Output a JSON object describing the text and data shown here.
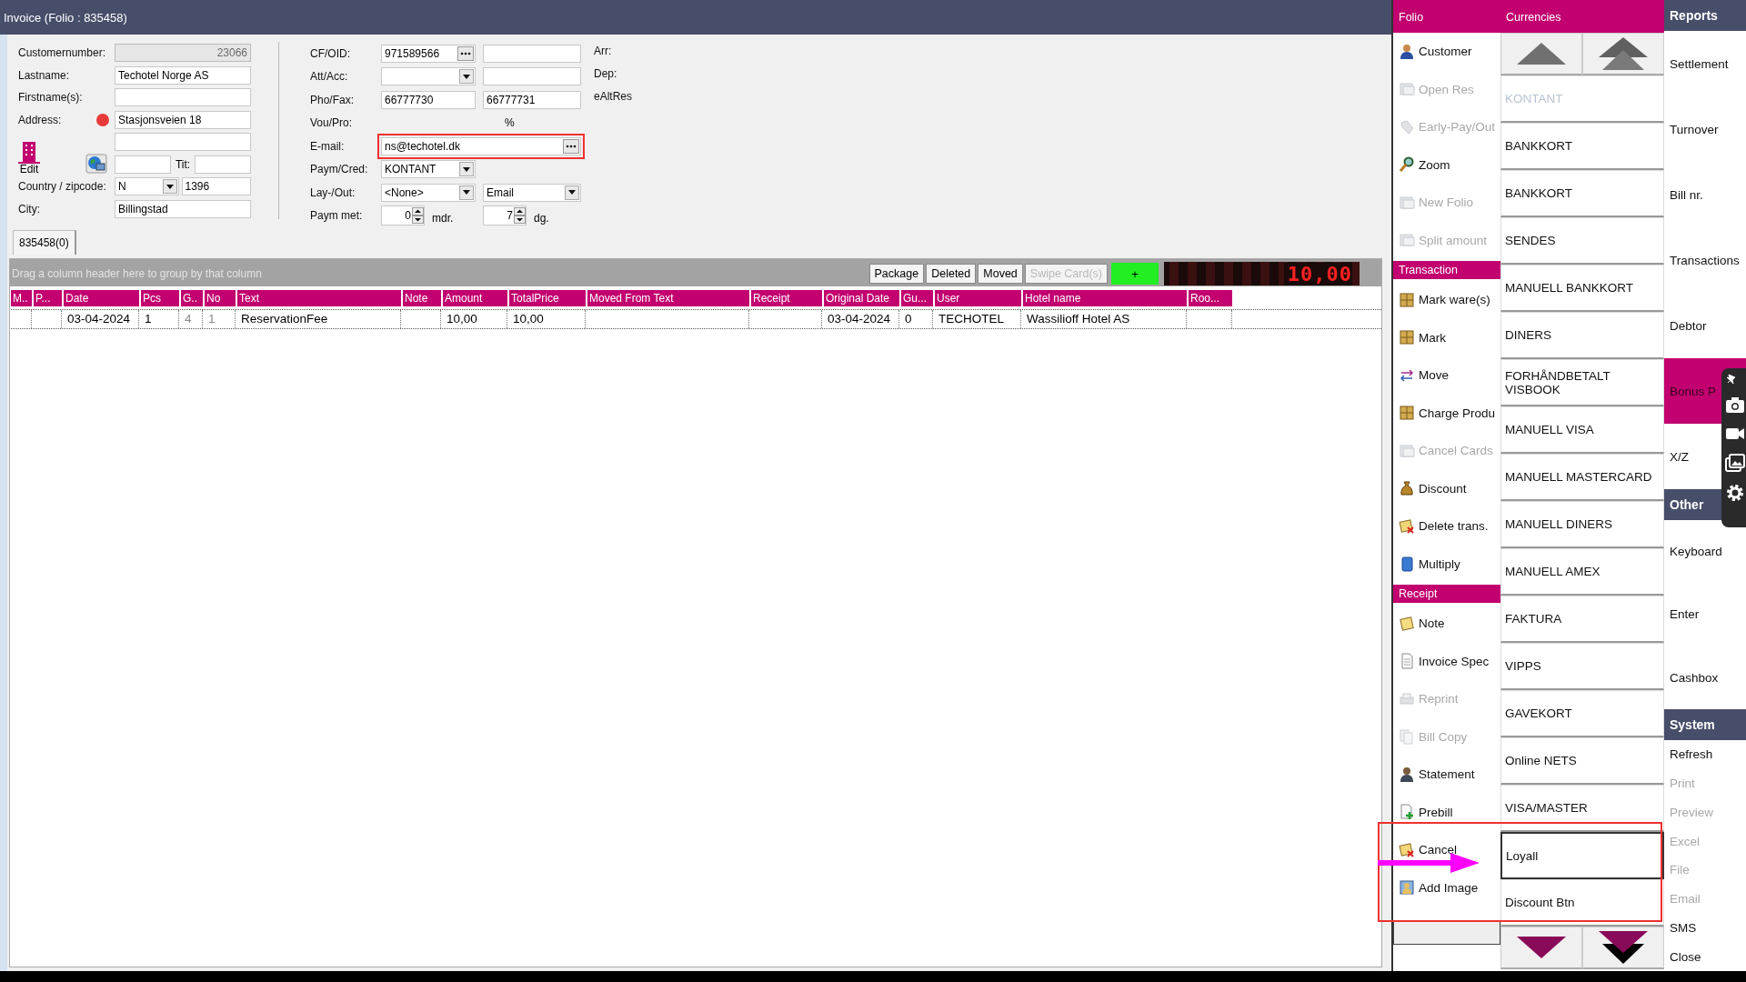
{
  "window": {
    "title": "Invoice (Folio : 835458)"
  },
  "customer": {
    "edit_button": {
      "label": "Edit"
    },
    "rows": [
      {
        "label": "Customernumber:",
        "flagged": false,
        "controls": [
          {
            "kind": "text",
            "value": "23066",
            "disabled": true
          }
        ]
      },
      {
        "label": "Lastname:",
        "flagged": false,
        "controls": [
          {
            "kind": "text",
            "value": "Techotel Norge AS",
            "disabled": false
          }
        ]
      },
      {
        "label": "Firstname(s):",
        "flagged": false,
        "controls": [
          {
            "kind": "text",
            "disabled": false
          }
        ]
      },
      {
        "label": "Address:",
        "flagged": true,
        "controls": [
          {
            "kind": "text",
            "value": "Stasjonsveien 18",
            "disabled": false
          }
        ]
      },
      {
        "flagged": false,
        "controls": [
          {
            "kind": "text",
            "disabled": false
          }
        ]
      },
      {
        "flagged": false,
        "controls": [
          {
            "kind": "text",
            "disabled": false
          },
          {
            "kind": "caption",
            "text": "Tit:"
          },
          {
            "kind": "text",
            "disabled": false
          }
        ]
      },
      {
        "label": "Country / zipcode:",
        "flagged": false,
        "controls": [
          {
            "kind": "combo",
            "value": "N"
          },
          {
            "kind": "text",
            "value": "1396",
            "disabled": false
          }
        ]
      },
      {
        "label": "City:",
        "flagged": false,
        "controls": [
          {
            "kind": "text",
            "value": "Billingstad",
            "disabled": false
          }
        ]
      }
    ]
  },
  "billing": {
    "rows": [
      {
        "label": "CF/OID:",
        "controls": [
          {
            "kind": "dots",
            "value": "971589566",
            "highlighted": false
          },
          {
            "kind": "text",
            "disabled": false
          }
        ]
      },
      {
        "label": "Att/Acc:",
        "controls": [
          {
            "kind": "combo"
          },
          {
            "kind": "text",
            "disabled": false
          }
        ]
      },
      {
        "label": "Pho/Fax:",
        "controls": [
          {
            "kind": "text",
            "value": "66777730",
            "disabled": false
          },
          {
            "kind": "text",
            "value": "66777731",
            "disabled": false
          }
        ]
      },
      {
        "label": "Vou/Pro:",
        "controls": [
          {
            "kind": "percent",
            "text": "%"
          }
        ]
      },
      {
        "label": "E-mail:",
        "controls": [
          {
            "kind": "dots",
            "value": "ns@techotel.dk",
            "highlighted": true
          }
        ]
      },
      {
        "label": "Paym/Cred:",
        "controls": [
          {
            "kind": "combo",
            "value": "KONTANT"
          }
        ]
      },
      {
        "label": "Lay-/Out:",
        "controls": [
          {
            "kind": "combo",
            "value": "<None>"
          },
          {
            "kind": "combo",
            "value": "Email"
          }
        ]
      },
      {
        "label": "Paym met:",
        "controls": [
          {
            "kind": "spin",
            "value": "0",
            "unit": "mdr."
          },
          {
            "kind": "spin",
            "value": "7",
            "unit": "dg."
          }
        ]
      }
    ]
  },
  "stay_info": [
    "Arr:",
    "Dep:",
    "eAltRes"
  ],
  "tabs": [
    {
      "label": "835458(0)",
      "selected": true
    }
  ],
  "grid": {
    "group_hint": "Drag a column header here to group by that column",
    "buttons": [
      {
        "label": "Package",
        "disabled": false
      },
      {
        "label": "Deleted",
        "disabled": false
      },
      {
        "label": "Moved",
        "disabled": false
      },
      {
        "label": "Swipe Card(s)",
        "disabled": true
      }
    ],
    "add_button": "+",
    "total_display": "10,00",
    "columns": [
      {
        "title": "M.."
      },
      {
        "title": "P..."
      },
      {
        "title": "Date",
        "dimmed": false
      },
      {
        "title": "Pcs",
        "dimmed": false
      },
      {
        "title": "G..",
        "dimmed": true
      },
      {
        "title": "No",
        "dimmed": true
      },
      {
        "title": "Text",
        "dimmed": false
      },
      {
        "title": "Note"
      },
      {
        "title": "Amount",
        "dimmed": false
      },
      {
        "title": "TotalPrice",
        "dimmed": false
      },
      {
        "title": "Moved From Text"
      },
      {
        "title": "Receipt"
      },
      {
        "title": "Original Date",
        "dimmed": false
      },
      {
        "title": "Gu...",
        "dimmed": false
      },
      {
        "title": "User",
        "dimmed": false
      },
      {
        "title": "Hotel name",
        "dimmed": false
      },
      {
        "title": "Roo..."
      }
    ],
    "rows": [
      [
        null,
        null,
        "03-04-2024",
        "1",
        "4",
        "1",
        "ReservationFee",
        null,
        "10,00",
        "10,00",
        null,
        null,
        "03-04-2024",
        "0",
        "TECHOTEL",
        "Wassilioff Hotel AS",
        null
      ]
    ]
  },
  "folio": {
    "title": "Folio",
    "groups": [
      {
        "items": [
          {
            "label": "Customer",
            "disabled": false
          },
          {
            "label": "Open Res",
            "disabled": true
          },
          {
            "label": "Early-Pay/Out",
            "disabled": true
          },
          {
            "label": "Zoom",
            "disabled": false
          },
          {
            "label": "New Folio",
            "disabled": true
          },
          {
            "label": "Split amount",
            "disabled": true
          }
        ]
      },
      {
        "title": "Transaction",
        "items": [
          {
            "label": "Mark ware(s)",
            "disabled": false
          },
          {
            "label": "Mark",
            "disabled": false
          },
          {
            "label": "Move",
            "disabled": false
          },
          {
            "label": "Charge Produ",
            "disabled": false
          },
          {
            "label": "Cancel Cards",
            "disabled": true
          },
          {
            "label": "Discount",
            "disabled": false
          },
          {
            "label": "Delete trans.",
            "disabled": false
          },
          {
            "label": "Multiply",
            "disabled": false
          }
        ]
      },
      {
        "title": "Receipt",
        "items": [
          {
            "label": "Note",
            "disabled": false
          },
          {
            "label": "Invoice Spec",
            "disabled": false
          },
          {
            "label": "Reprint",
            "disabled": true
          },
          {
            "label": "Bill Copy",
            "disabled": true
          },
          {
            "label": "Statement",
            "disabled": false
          },
          {
            "label": "Prebill",
            "disabled": false
          },
          {
            "label": "Cancel",
            "disabled": false
          },
          {
            "label": "Add Image",
            "disabled": false
          }
        ]
      }
    ]
  },
  "currencies": {
    "title": "Currencies",
    "items": [
      {
        "label": "KONTANT",
        "disabled": true,
        "selected": false
      },
      {
        "label": "BANKKORT",
        "disabled": false,
        "selected": false
      },
      {
        "label": "BANKKORT",
        "disabled": false,
        "selected": false
      },
      {
        "label": "SENDES",
        "disabled": false,
        "selected": false
      },
      {
        "label": "MANUELL BANKKORT",
        "disabled": false,
        "selected": false
      },
      {
        "label": "DINERS",
        "disabled": false,
        "selected": false
      },
      {
        "label": "FORHÅNDBETALT VISBOOK",
        "disabled": false,
        "selected": false
      },
      {
        "label": "MANUELL VISA",
        "disabled": false,
        "selected": false
      },
      {
        "label": "MANUELL MASTERCARD",
        "disabled": false,
        "selected": false
      },
      {
        "label": "MANUELL DINERS",
        "disabled": false,
        "selected": false
      },
      {
        "label": "MANUELL AMEX",
        "disabled": false,
        "selected": false
      },
      {
        "label": "FAKTURA",
        "disabled": false,
        "selected": false
      },
      {
        "label": "VIPPS",
        "disabled": false,
        "selected": false
      },
      {
        "label": "GAVEKORT",
        "disabled": false,
        "selected": false
      },
      {
        "label": "Online NETS",
        "disabled": false,
        "selected": false
      },
      {
        "label": "VISA/MASTER",
        "disabled": false,
        "selected": false
      },
      {
        "label": "Loyall",
        "disabled": false,
        "selected": true
      },
      {
        "label": "Discount Btn",
        "disabled": false,
        "selected": false
      }
    ]
  },
  "reports": {
    "groups": [
      {
        "title": "Reports",
        "items": [
          {
            "label": "Settlement",
            "selected": false,
            "disabled": false
          },
          {
            "label": "Turnover",
            "selected": false,
            "disabled": false
          },
          {
            "label": "Bill nr.",
            "selected": false,
            "disabled": false
          },
          {
            "label": "Transactions",
            "selected": false,
            "disabled": false
          },
          {
            "label": "Debtor",
            "selected": false,
            "disabled": false
          },
          {
            "label": "Bonus P",
            "selected": true,
            "disabled": false
          },
          {
            "label": "X/Z",
            "selected": false,
            "disabled": false
          }
        ]
      },
      {
        "title": "Other",
        "items": [
          {
            "label": "Keyboard",
            "selected": false,
            "disabled": false
          },
          {
            "label": "Enter",
            "selected": false,
            "disabled": false
          },
          {
            "label": "Cashbox",
            "selected": false,
            "disabled": false
          }
        ]
      },
      {
        "title": "System",
        "items": [
          {
            "label": "Refresh",
            "selected": false,
            "disabled": false
          },
          {
            "label": "Print",
            "selected": false,
            "disabled": true
          },
          {
            "label": "Preview",
            "selected": false,
            "disabled": true
          },
          {
            "label": "Excel",
            "selected": false,
            "disabled": true
          },
          {
            "label": "File",
            "selected": false,
            "disabled": true
          },
          {
            "label": "Email",
            "selected": false,
            "disabled": true
          },
          {
            "label": "SMS",
            "selected": false,
            "disabled": false
          },
          {
            "label": "Close",
            "selected": false,
            "disabled": false
          }
        ]
      }
    ]
  },
  "annotations": [
    {
      "kind": "frame",
      "color": "#f03030"
    },
    {
      "kind": "arrow",
      "color": "#ff00ff"
    }
  ]
}
